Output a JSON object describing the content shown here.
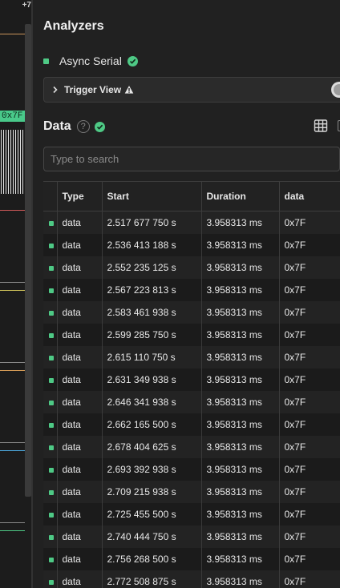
{
  "waveform": {
    "corner_label": "+7",
    "frame_tag": "0x7F"
  },
  "panel": {
    "title": "Analyzers"
  },
  "analyzer": {
    "name": "Async Serial",
    "status": "ok",
    "color": "#4ec985"
  },
  "trigger": {
    "label": "Trigger View",
    "warning_icon": "warning-icon",
    "toggle_on": true
  },
  "data_section": {
    "title": "Data",
    "help_icon": "?",
    "view_icon": "grid-icon"
  },
  "search": {
    "placeholder": "Type to search",
    "value": ""
  },
  "table": {
    "columns": [
      "",
      "Type",
      "Start",
      "Duration",
      "data"
    ],
    "rows": [
      {
        "type": "data",
        "start": "2.517 677 750 s",
        "duration": "3.958313 ms",
        "data": "0x7F"
      },
      {
        "type": "data",
        "start": "2.536 413 188 s",
        "duration": "3.958313 ms",
        "data": "0x7F"
      },
      {
        "type": "data",
        "start": "2.552 235 125 s",
        "duration": "3.958313 ms",
        "data": "0x7F"
      },
      {
        "type": "data",
        "start": "2.567 223 813 s",
        "duration": "3.958313 ms",
        "data": "0x7F"
      },
      {
        "type": "data",
        "start": "2.583 461 938 s",
        "duration": "3.958313 ms",
        "data": "0x7F"
      },
      {
        "type": "data",
        "start": "2.599 285 750 s",
        "duration": "3.958313 ms",
        "data": "0x7F"
      },
      {
        "type": "data",
        "start": "2.615 110 750 s",
        "duration": "3.958313 ms",
        "data": "0x7F"
      },
      {
        "type": "data",
        "start": "2.631 349 938 s",
        "duration": "3.958313 ms",
        "data": "0x7F"
      },
      {
        "type": "data",
        "start": "2.646 341 938 s",
        "duration": "3.958313 ms",
        "data": "0x7F"
      },
      {
        "type": "data",
        "start": "2.662 165 500 s",
        "duration": "3.958313 ms",
        "data": "0x7F"
      },
      {
        "type": "data",
        "start": "2.678 404 625 s",
        "duration": "3.958313 ms",
        "data": "0x7F"
      },
      {
        "type": "data",
        "start": "2.693 392 938 s",
        "duration": "3.958313 ms",
        "data": "0x7F"
      },
      {
        "type": "data",
        "start": "2.709 215 938 s",
        "duration": "3.958313 ms",
        "data": "0x7F"
      },
      {
        "type": "data",
        "start": "2.725 455 500 s",
        "duration": "3.958313 ms",
        "data": "0x7F"
      },
      {
        "type": "data",
        "start": "2.740 444 750 s",
        "duration": "3.958313 ms",
        "data": "0x7F"
      },
      {
        "type": "data",
        "start": "2.756 268 500 s",
        "duration": "3.958313 ms",
        "data": "0x7F"
      },
      {
        "type": "data",
        "start": "2.772 508 875 s",
        "duration": "3.958313 ms",
        "data": "0x7F"
      }
    ]
  },
  "colors": {
    "accent_green": "#4ec985",
    "background": "#212121"
  }
}
